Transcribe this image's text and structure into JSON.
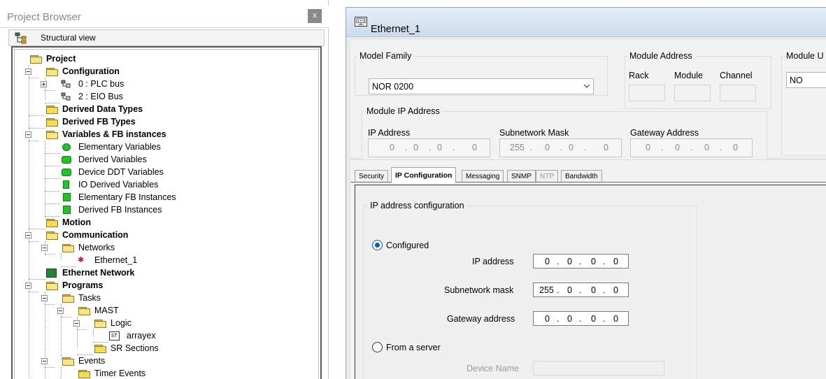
{
  "project_browser": {
    "title": "Project Browser",
    "close_glyph": "x",
    "view_label": "Structural view",
    "tree": [
      {
        "label": "Project",
        "bold": true
      },
      {
        "label": "Configuration",
        "bold": true
      },
      {
        "label": "0 : PLC bus",
        "bold": false
      },
      {
        "label": "2 : EIO Bus",
        "bold": false
      },
      {
        "label": "Derived Data Types",
        "bold": true
      },
      {
        "label": "Derived FB Types",
        "bold": true
      },
      {
        "label": "Variables & FB instances",
        "bold": true
      },
      {
        "label": "Elementary Variables",
        "bold": false
      },
      {
        "label": "Derived Variables",
        "bold": false
      },
      {
        "label": "Device DDT Variables",
        "bold": false
      },
      {
        "label": "IO Derived Variables",
        "bold": false
      },
      {
        "label": "Elementary FB Instances",
        "bold": false
      },
      {
        "label": "Derived FB Instances",
        "bold": false
      },
      {
        "label": "Motion",
        "bold": true
      },
      {
        "label": "Communication",
        "bold": true
      },
      {
        "label": "Networks",
        "bold": false
      },
      {
        "label": "Ethernet_1",
        "bold": false
      },
      {
        "label": "Ethernet Network",
        "bold": true
      },
      {
        "label": "Programs",
        "bold": true
      },
      {
        "label": "Tasks",
        "bold": false
      },
      {
        "label": "MAST",
        "bold": false
      },
      {
        "label": "Logic",
        "bold": false
      },
      {
        "label": "arrayex",
        "bold": false
      },
      {
        "label": "SR Sections",
        "bold": false
      },
      {
        "label": "Events",
        "bold": false
      },
      {
        "label": "Timer Events",
        "bold": false
      }
    ]
  },
  "editor": {
    "title": "Ethernet_1",
    "model_family": {
      "label": "Model Family",
      "value": "NOR 0200"
    },
    "module_address": {
      "label": "Module Address",
      "rack": "Rack",
      "module": "Module",
      "channel": "Channel"
    },
    "module_util": {
      "label": "Module U",
      "value": "NO"
    },
    "module_ip": {
      "label": "Module IP Address",
      "ip_label": "IP Address",
      "ip": [
        "0",
        "0",
        "0",
        "0"
      ],
      "mask_label": "Subnetwork Mask",
      "mask": [
        "255",
        "0",
        "0",
        "0"
      ],
      "gw_label": "Gateway Address",
      "gw": [
        "0",
        "0",
        "0",
        "0"
      ]
    },
    "tabs": [
      "Security",
      "IP Configuration",
      "Messaging",
      "SNMP",
      "NTP",
      "Bandwidth"
    ],
    "active_tab": "IP Configuration",
    "ip_config": {
      "group_label": "IP address configuration",
      "configured_label": "Configured",
      "ip_address_label": "IP address",
      "ip_address": [
        "0",
        "0",
        "0",
        "0"
      ],
      "mask_label": "Subnetwork mask",
      "mask": [
        "255",
        "0",
        "0",
        "0"
      ],
      "gateway_label": "Gateway address",
      "gateway": [
        "0",
        "0",
        "0",
        "0"
      ],
      "from_server_label": "From a server",
      "device_name_label": "Device Name"
    }
  }
}
